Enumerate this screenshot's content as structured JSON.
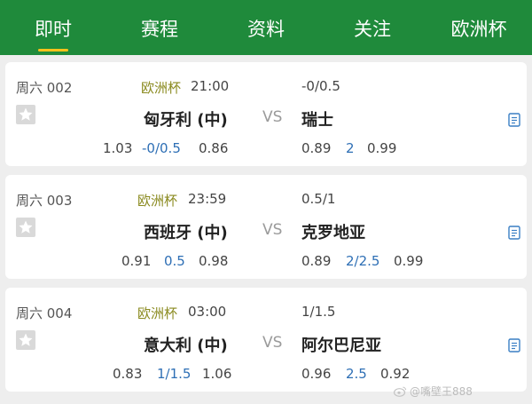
{
  "tabs": [
    {
      "label": "即时",
      "active": true
    },
    {
      "label": "赛程",
      "active": false
    },
    {
      "label": "资料",
      "active": false
    },
    {
      "label": "关注",
      "active": false
    },
    {
      "label": "欧洲杯",
      "active": false
    }
  ],
  "matches": [
    {
      "week_no": "周六 002",
      "league": "欧洲杯",
      "kickoff": "21:00",
      "handicap_top": "-0/0.5",
      "home": "匈牙利 (中)",
      "vs": "VS",
      "away": "瑞士",
      "odds_left": [
        "1.03",
        "-0/0.5",
        "0.86"
      ],
      "odds_right": [
        "0.89",
        "2",
        "0.99"
      ]
    },
    {
      "week_no": "周六 003",
      "league": "欧洲杯",
      "kickoff": "23:59",
      "handicap_top": "0.5/1",
      "home": "西班牙 (中)",
      "vs": "VS",
      "away": "克罗地亚",
      "odds_left": [
        "0.91",
        "0.5",
        "0.98"
      ],
      "odds_right": [
        "0.89",
        "2/2.5",
        "0.99"
      ]
    },
    {
      "week_no": "周六 004",
      "league": "欧洲杯",
      "kickoff": "03:00",
      "handicap_top": "1/1.5",
      "home": "意大利 (中)",
      "vs": "VS",
      "away": "阿尔巴尼亚",
      "odds_left": [
        "0.83",
        "1/1.5",
        "1.06"
      ],
      "odds_right": [
        "0.96",
        "2.5",
        "0.92"
      ]
    }
  ],
  "watermark": "@嘴壁王888",
  "icons": {
    "favorite": "star-icon",
    "detail": "document-icon",
    "watermark": "weibo-icon"
  },
  "colors": {
    "topbar": "#1f8a3b",
    "tab_underline": "#ffc21a",
    "league": "#8a8a1f",
    "handicap_blue": "#2e6fb5",
    "background": "#eeeeee"
  }
}
